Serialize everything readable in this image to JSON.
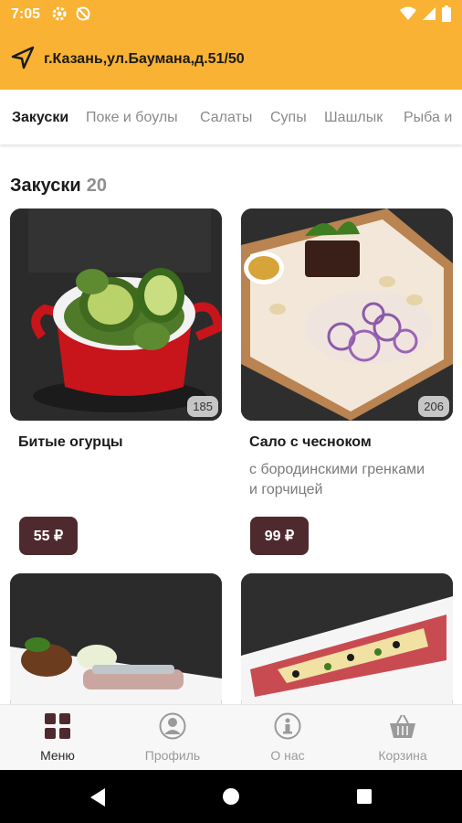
{
  "status_bar": {
    "time": "7:05"
  },
  "header": {
    "address": "г.Казань,ул.Баумана,д.51/50"
  },
  "tabs": [
    "Закуски",
    "Поке и боулы",
    "Салаты",
    "Супы",
    "Шашлык",
    "Рыба и"
  ],
  "section": {
    "title": "Закуски",
    "count": "20"
  },
  "products": [
    {
      "name": "Битые огурцы",
      "description": "",
      "weight": "185",
      "price": "55 ₽"
    },
    {
      "name": "Сало с чесноком",
      "description": "с бородинскими гренками и горчицей",
      "weight": "206",
      "price": "99 ₽"
    }
  ],
  "bottom_nav": [
    {
      "label": "Меню",
      "icon": "grid-icon"
    },
    {
      "label": "Профиль",
      "icon": "profile-icon"
    },
    {
      "label": "О нас",
      "icon": "info-icon"
    },
    {
      "label": "Корзина",
      "icon": "basket-icon"
    }
  ],
  "colors": {
    "accent": "#f9b233",
    "price_bg": "#4e2a2f"
  }
}
